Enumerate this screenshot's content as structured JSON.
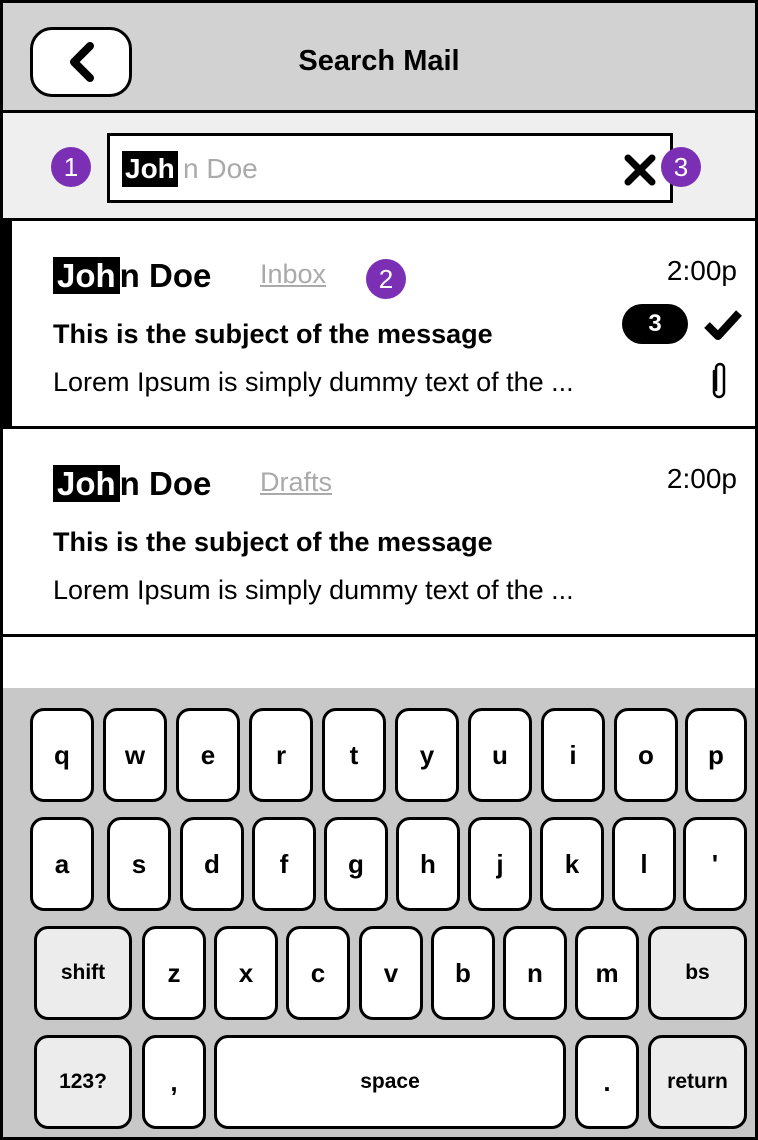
{
  "header": {
    "title": "Search Mail",
    "back_icon": "chevron-left-icon"
  },
  "search": {
    "typed": "Joh",
    "suggestion": "n Doe",
    "clear_icon": "close-icon"
  },
  "callouts": {
    "one": "1",
    "two": "2",
    "three": "3"
  },
  "colors": {
    "callout": "#7b2fb5",
    "header_bg": "#d2d2d2",
    "keyboard_bg": "#c8c8c8"
  },
  "messages": [
    {
      "sender_match": "Joh",
      "sender_rest": "n Doe",
      "folder": "Inbox",
      "time": "2:00p",
      "subject": "This is the subject of the message",
      "preview": "Lorem Ipsum is simply dummy text of the ...",
      "count": "3",
      "selected": true,
      "icons": [
        "check-icon",
        "paperclip-icon"
      ]
    },
    {
      "sender_match": "Joh",
      "sender_rest": "n Doe",
      "folder": "Drafts",
      "time": "2:00p",
      "subject": "This is the subject of the message",
      "preview": "Lorem Ipsum is simply dummy text of the ..."
    }
  ],
  "keyboard": {
    "row1": [
      "q",
      "w",
      "e",
      "r",
      "t",
      "y",
      "u",
      "i",
      "o",
      "p"
    ],
    "row2": [
      "a",
      "s",
      "d",
      "f",
      "g",
      "h",
      "j",
      "k",
      "l",
      "'"
    ],
    "row3": [
      "shift",
      "z",
      "x",
      "c",
      "v",
      "b",
      "n",
      "m",
      "bs"
    ],
    "row4": [
      "123?",
      ",",
      "space",
      ".",
      "return"
    ]
  }
}
